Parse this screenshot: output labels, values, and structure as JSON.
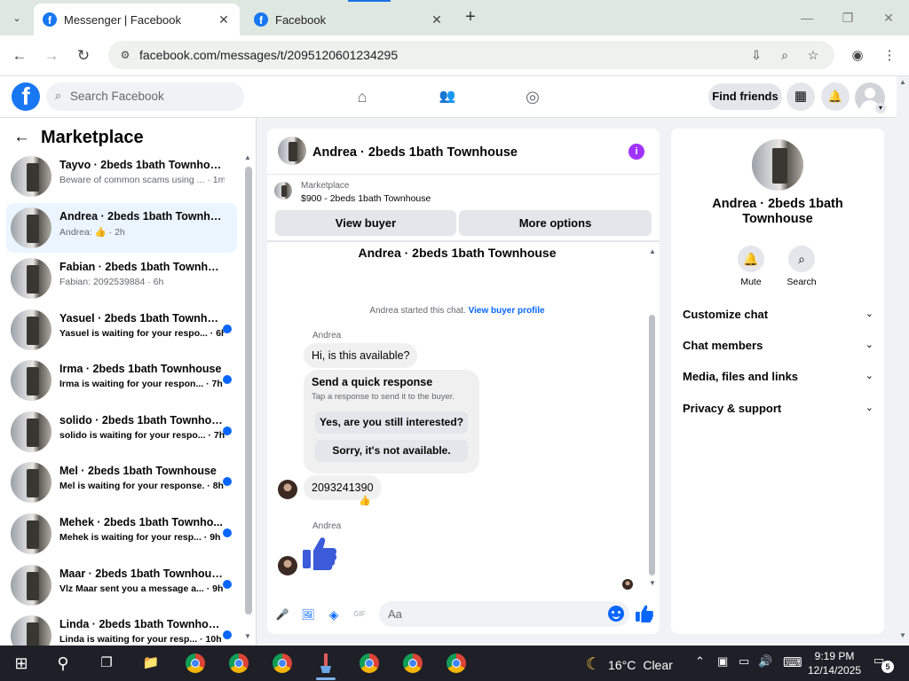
{
  "browser": {
    "tabs": [
      {
        "title": "Messenger | Facebook",
        "favicon": "f"
      },
      {
        "title": "Facebook",
        "favicon": "f"
      }
    ],
    "url": "facebook.com/messages/t/2095120601234295",
    "icons": {
      "tab_search": "⌄",
      "close": "✕",
      "new_tab": "+",
      "minimize": "—",
      "restore": "❐",
      "window_close": "✕",
      "back": "←",
      "forward": "→",
      "reload": "↻",
      "site_info": "⚙",
      "install": "⇩",
      "zoom": "⌕",
      "bookmark": "☆",
      "profile": "◉",
      "menu": "⋮"
    }
  },
  "fb_header": {
    "logo": "f",
    "search_placeholder": "Search Facebook",
    "search_icon": "⌕",
    "nav": {
      "home": "⌂",
      "friends": "👥",
      "groups": "◎"
    },
    "find_friends": "Find friends",
    "menu_icon": "▦",
    "bell_icon": "🔔",
    "chevron": "▾"
  },
  "sidebar": {
    "back": "←",
    "title": "Marketplace",
    "conversations": [
      {
        "name": "Tayvo · 2beds 1bath Townhouse",
        "snippet": "Beware of common scams using ... · 1m"
      },
      {
        "name": "Andrea · 2beds 1bath Townhouse",
        "snippet": "Andrea: 👍 · 2h"
      },
      {
        "name": "Fabian · 2beds 1bath Townhouse",
        "snippet": "Fabian: 2092539884 · 6h"
      },
      {
        "name": "Yasuel · 2beds 1bath Townhouse",
        "snippet": "Yasuel is waiting for your respo... · 6h"
      },
      {
        "name": "Irma · 2beds 1bath Townhouse",
        "snippet": "Irma is waiting for your respon... · 7h"
      },
      {
        "name": "solido · 2beds 1bath Townhouse",
        "snippet": "solido is waiting for your respo... · 7h"
      },
      {
        "name": "Mel · 2beds 1bath Townhouse",
        "snippet": "Mel is waiting for your response. · 8h"
      },
      {
        "name": "Mehek · 2beds 1bath Townho...",
        "snippet": "Mehek is waiting for your resp... · 9h"
      },
      {
        "name": "Maar · 2beds 1bath Townhouse",
        "snippet": "Vlz Maar sent you a message a... · 9h"
      },
      {
        "name": "Linda · 2beds 1bath Townhouse",
        "snippet": "Linda is waiting for your resp... · 10h"
      }
    ],
    "scroll_up": "▲",
    "scroll_down": "▼"
  },
  "chat": {
    "title": "Andrea · 2beds 1bath Townhouse",
    "info_icon": "i",
    "marketplace_label": "Marketplace",
    "listing": "$900 - 2beds 1bath Townhouse",
    "view_buyer": "View buyer",
    "more_options": "More options",
    "thread_title": "Andrea · 2beds 1bath Townhouse",
    "started_text": "Andrea started this chat.",
    "view_buyer_profile": "View buyer profile",
    "sender_1": "Andrea",
    "msg_1": "Hi, is this available?",
    "quick_title": "Send a quick response",
    "quick_sub": "Tap a response to send it to the buyer.",
    "quick_1": "Yes, are you still interested?",
    "quick_2": "Sorry, it's not available.",
    "msg_2": "2093241390",
    "reaction": "👍",
    "sender_2": "Andrea",
    "composer_placeholder": "Aa",
    "composer_icons": {
      "mic": "🎤",
      "image": "🖼",
      "sticker": "◈",
      "gif": "GIF"
    },
    "scroll_up": "▲",
    "scroll_down": "▼"
  },
  "right_panel": {
    "name": "Andrea · 2beds 1bath Townhouse",
    "actions": [
      {
        "label": "Mute",
        "icon": "🔔"
      },
      {
        "label": "Search",
        "icon": "⌕"
      }
    ],
    "sections": [
      {
        "label": "Customize chat",
        "chevron": "⌄"
      },
      {
        "label": "Chat members",
        "chevron": "⌄"
      },
      {
        "label": "Media, files and links",
        "chevron": "⌄"
      },
      {
        "label": "Privacy & support",
        "chevron": "⌄"
      }
    ]
  },
  "page_scroll": {
    "up": "▲",
    "down": "▼"
  },
  "taskbar": {
    "start": "⊞",
    "search": "⚲",
    "taskview": "❐",
    "explorer": "📁",
    "weather_icon": "☾",
    "temperature": "16°C",
    "weather_text": "Clear",
    "tray": {
      "chevron": "⌃",
      "meet": "▣",
      "network": "▭",
      "volume": "🔊",
      "keyboard": "⌨"
    },
    "time": "9:19 PM",
    "date": "12/14/2025",
    "notifications": "5",
    "notif_icon": "▭"
  },
  "colors": {
    "fb_blue": "#1877f2",
    "messenger_blue": "#0866ff",
    "info_purple": "#a033ff"
  }
}
